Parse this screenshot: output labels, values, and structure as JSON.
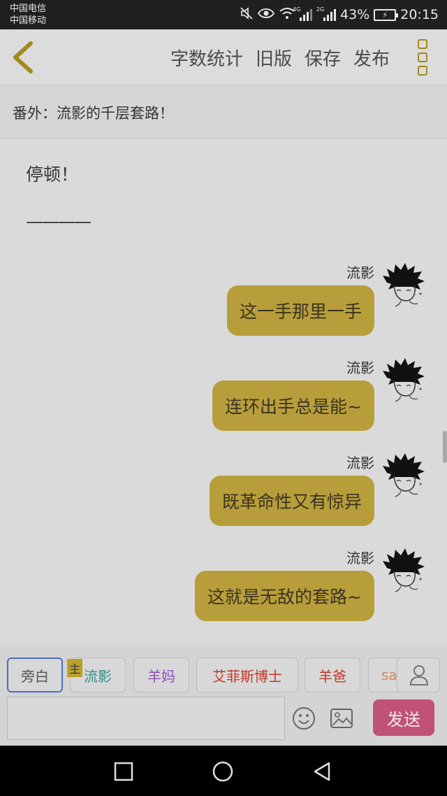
{
  "status_bar": {
    "carrier1": "中国电信",
    "carrier2": "中国移动",
    "network1": "4G",
    "network2": "2G",
    "battery_pct": "43%",
    "time": "20:15"
  },
  "header": {
    "actions": [
      "字数统计",
      "旧版",
      "保存",
      "发布"
    ]
  },
  "chapter": {
    "title": "番外：流影的千层套路！"
  },
  "content": {
    "narration": [
      "停顿！",
      "————"
    ],
    "messages": [
      {
        "speaker": "流影",
        "text": "这一手那里一手"
      },
      {
        "speaker": "流影",
        "text": "连环出手总是能~"
      },
      {
        "speaker": "流影",
        "text": "既革命性又有惊异"
      },
      {
        "speaker": "流影",
        "text": "这就是无敌的套路~"
      }
    ]
  },
  "roles": [
    {
      "label": "旁白",
      "color": "#555555"
    },
    {
      "label": "流影",
      "color": "#2f8f88"
    },
    {
      "label": "羊妈",
      "color": "#8a4fb8"
    },
    {
      "label": "艾菲斯博士",
      "color": "#c0392b"
    },
    {
      "label": "羊爸",
      "color": "#c0392b"
    },
    {
      "label": "sa",
      "color": "#d08860"
    }
  ],
  "main_badge": "主",
  "send_label": "发送",
  "colors": {
    "bubble": "#b89e3a",
    "send": "#c05277",
    "accent": "#a08a1e"
  }
}
